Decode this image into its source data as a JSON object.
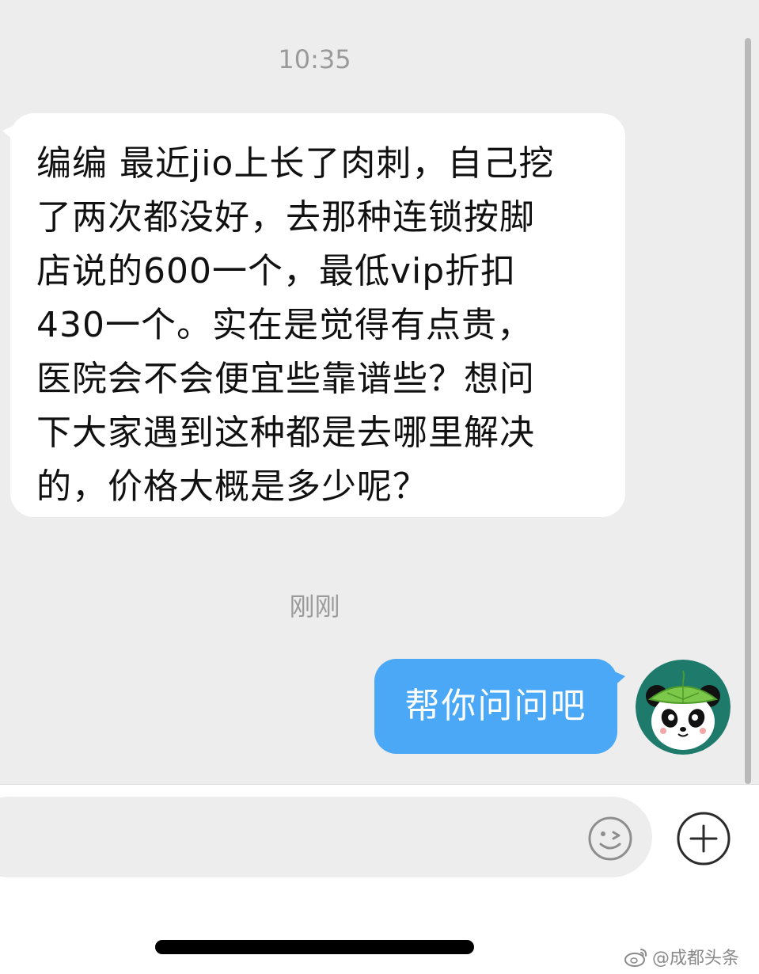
{
  "conversation": {
    "timestamps": [
      "10:35",
      "刚刚"
    ],
    "incoming_message": {
      "lines": [
        "编编 最近jio上长了肉刺，自己挖",
        "了两次都没好，去那种连锁按脚",
        "店说的600一个，最低vip折扣",
        "430一个。实在是觉得有点贵，",
        "医院会不会便宜些靠谱些？想问",
        "下大家遇到这种都是去哪里解决",
        "的，价格大概是多少呢？"
      ]
    },
    "outgoing_message": {
      "text": "帮你问问吧"
    },
    "avatar_icon": "panda-leaf-avatar"
  },
  "input_bar": {
    "placeholder": "",
    "emoji_icon": "smiley-icon",
    "plus_icon": "plus-circle-icon"
  },
  "watermark": {
    "text": "@成都头条",
    "icon": "weibo-icon"
  },
  "colors": {
    "chat_background": "#ededed",
    "outgoing_bubble": "#4aa8f6",
    "incoming_bubble": "#ffffff",
    "avatar_background": "#1e7a6a"
  }
}
